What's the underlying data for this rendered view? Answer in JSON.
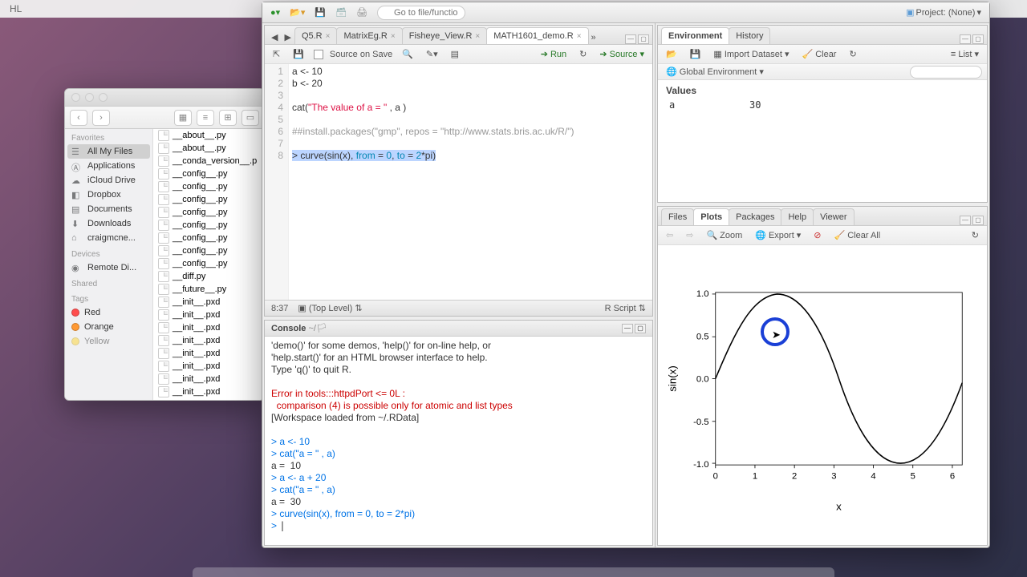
{
  "menubar": {
    "title": "HL"
  },
  "finder": {
    "favorites_label": "Favorites",
    "devices_label": "Devices",
    "shared_label": "Shared",
    "tags_label": "Tags",
    "favorites": [
      "All My Files",
      "iCloud Drive",
      "Dropbox",
      "Documents",
      "Downloads",
      "craigmcne..."
    ],
    "apps_label": "Applications",
    "devices": [
      "Remote Di..."
    ],
    "tags": [
      {
        "label": "Red",
        "color": "#ff4d4d"
      },
      {
        "label": "Orange",
        "color": "#ff9933"
      },
      {
        "label": "Yellow",
        "color": "#ffd633"
      }
    ],
    "files": [
      "__about__.py",
      "__about__.py",
      "__conda_version__.p",
      "__config__.py",
      "__config__.py",
      "__config__.py",
      "__config__.py",
      "__config__.py",
      "__config__.py",
      "__config__.py",
      "__config__.py",
      "__diff.py",
      "__future__.py",
      "__init__.pxd",
      "__init__.pxd",
      "__init__.pxd",
      "__init__.pxd",
      "__init__.pxd",
      "__init__.pxd",
      "__init__.pxd",
      "__init__.pxd"
    ]
  },
  "rstudio": {
    "project_label": "Project: (None)",
    "goto_placeholder": "Go to file/function",
    "editor": {
      "tabs": [
        "Q5.R",
        "MatrixEg.R",
        "Fisheye_View.R",
        "MATH1601_demo.R"
      ],
      "active_tab": 3,
      "source_on_save": "Source on Save",
      "run_label": "Run",
      "source_label": "Source",
      "lines": {
        "l1": "a <- 10",
        "l2": "b <- 20",
        "l3": "",
        "l4p1": "cat(",
        "l4str": "\"The value of a = \"",
        "l4p2": " , a )",
        "l5": "",
        "l6": "##install.packages(\"gmp\", repos = \"http://www.stats.bris.ac.uk/R/\")",
        "l7": "",
        "l8p0": "> ",
        "l8fn": "curve",
        "l8p1": "(",
        "l8fn2": "sin",
        "l8p2": "(x), ",
        "l8kw1": "from",
        "l8p3": " = ",
        "l8n1": "0",
        "l8p4": ", ",
        "l8kw2": "to",
        "l8p5": " = ",
        "l8n2": "2",
        "l8p6": "*pi)"
      },
      "cursor": "8:37",
      "scope": "(Top Level)",
      "lang": "R Script"
    },
    "console": {
      "title": "Console",
      "path": "~/",
      "text1": "'demo()' for some demos, 'help()' for on-line help, or",
      "text2": "'help.start()' for an HTML browser interface to help.",
      "text3": "Type 'q()' to quit R.",
      "err1": "Error in tools:::httpdPort <= 0L : ",
      "err2": "  comparison (4) is possible only for atomic and list types",
      "text4": "[Workspace loaded from ~/.RData]",
      "c1": "a <- 10",
      "c2": "cat(\"a = \" , a)",
      "c3": "a =  10",
      "c4": "a <- a + 20",
      "c5": "cat(\"a = \" , a)",
      "c6": "a =  30",
      "c7": "curve(sin(x), from = 0, to = 2*pi)"
    },
    "env": {
      "tab1": "Environment",
      "tab2": "History",
      "import_label": "Import Dataset",
      "clear_label": "Clear",
      "list_label": "List",
      "global_env": "Global Environment",
      "values_hdr": "Values",
      "rows": [
        {
          "name": "a",
          "value": "30"
        }
      ]
    },
    "plots": {
      "tabs": [
        "Files",
        "Plots",
        "Packages",
        "Help",
        "Viewer"
      ],
      "active": 1,
      "zoom": "Zoom",
      "export": "Export",
      "clearall": "Clear All"
    }
  },
  "chart_data": {
    "type": "line",
    "title": "",
    "xlabel": "x",
    "ylabel": "sin(x)",
    "xlim": [
      0,
      6.283
    ],
    "ylim": [
      -1.0,
      1.0
    ],
    "xticks": [
      0,
      1,
      2,
      3,
      4,
      5,
      6
    ],
    "yticks": [
      -1.0,
      -0.5,
      0.0,
      0.5,
      1.0
    ],
    "series": [
      {
        "name": "sin(x)",
        "x_range": [
          0,
          6.283
        ],
        "formula": "sin(x)"
      }
    ]
  }
}
